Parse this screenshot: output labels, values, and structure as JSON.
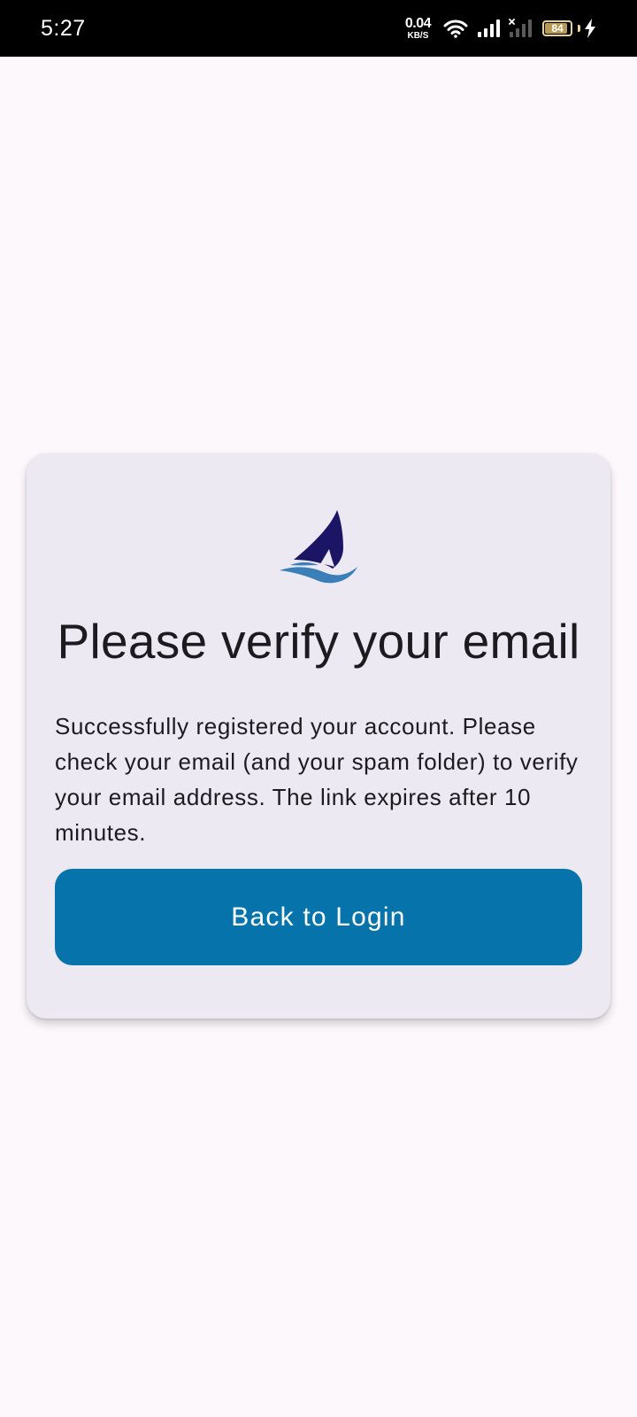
{
  "status_bar": {
    "time": "5:27",
    "net_speed_value": "0.04",
    "net_speed_unit": "KB/S",
    "battery_level": "84",
    "icons": [
      "wifi-icon",
      "cell-signal-icon",
      "cell-signal-no-service-icon",
      "battery-icon",
      "charging-bolt-icon"
    ]
  },
  "card": {
    "logo_icon": "sailboat-logo",
    "title": "Please verify your email",
    "message": "Successfully registered your account. Please check your email (and your spam folder) to verify your email address. The link expires after 10 minutes.",
    "button_label": "Back to Login"
  },
  "colors": {
    "background": "#fdf8fc",
    "card_background": "#ece9f2",
    "button": "#0674ab",
    "logo_sail": "#1c1464",
    "logo_wave": "#3b7fb8"
  }
}
